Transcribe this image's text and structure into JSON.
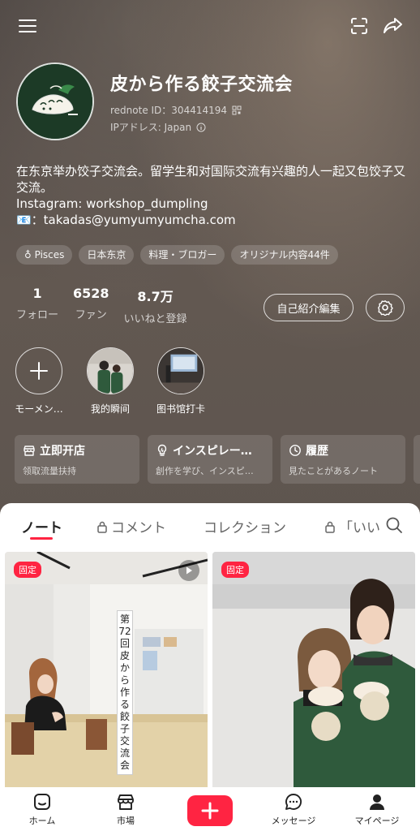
{
  "profile": {
    "name": "皮から作る餃子交流会",
    "id_line": "rednote ID：304414194",
    "ip_line": "IPアドレス: Japan",
    "bio": [
      "在东京举办饺子交流会。留学生和对国际交流有兴趣的人一起又包饺子又",
      "交流。",
      "Instagram: workshop_dumpling",
      "📧：takadas@yumyumyumcha.com"
    ],
    "tags": [
      "♁ Pisces",
      "日本东京",
      "料理・ブロガー",
      "オリジナル内容44件"
    ]
  },
  "stats": [
    {
      "value": "1",
      "label": "フォロー"
    },
    {
      "value": "6528",
      "label": "ファン"
    },
    {
      "value": "8.7万",
      "label": "いいねと登録"
    }
  ],
  "actions": {
    "edit": "自己紹介編集"
  },
  "moments": [
    {
      "label": "モーメン…"
    },
    {
      "label": "我的瞬间"
    },
    {
      "label": "图书馆打卡"
    }
  ],
  "cards": [
    {
      "title": "立即开店",
      "sub": "领取流量扶持"
    },
    {
      "title": "インスピレー…",
      "sub": "創作を学び、インスピ…"
    },
    {
      "title": "履歴",
      "sub": "見たことがあるノート"
    }
  ],
  "tabs": [
    {
      "label": "ノート"
    },
    {
      "label": "コメント"
    },
    {
      "label": "コレクション"
    },
    {
      "label": "「いい"
    }
  ],
  "notes": [
    {
      "badge": "固定",
      "overlay_text": "第72回皮から作る餃子交流会"
    },
    {
      "badge": "固定"
    }
  ],
  "nav": [
    {
      "label": "ホーム"
    },
    {
      "label": "市場"
    },
    {
      "label": "メッセージ"
    },
    {
      "label": "マイページ"
    }
  ],
  "colors": {
    "accent": "#ff2442",
    "avatar_bg": "#1c3a26",
    "apron": "#2f5a3c"
  }
}
